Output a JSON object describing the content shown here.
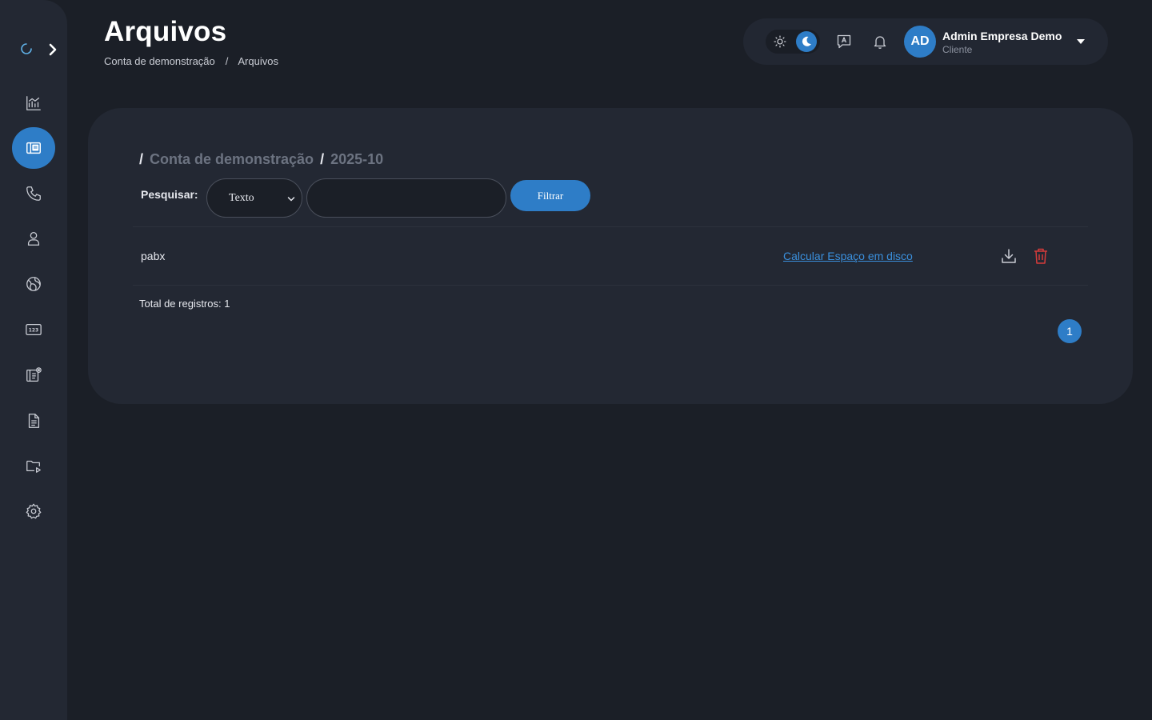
{
  "header": {
    "title": "Arquivos",
    "breadcrumb": [
      "Conta de demonstração",
      "Arquivos"
    ],
    "breadcrumb_separator": "/"
  },
  "sidebar": {
    "items": [
      {
        "icon": "chart-icon",
        "active": false
      },
      {
        "icon": "files-icon",
        "active": true
      },
      {
        "icon": "phone-icon",
        "active": false
      },
      {
        "icon": "user-icon",
        "active": false
      },
      {
        "icon": "globe-icon",
        "active": false
      },
      {
        "icon": "numbers-icon",
        "active": false
      },
      {
        "icon": "book-settings-icon",
        "active": false
      },
      {
        "icon": "document-icon",
        "active": false
      },
      {
        "icon": "folder-play-icon",
        "active": false
      },
      {
        "icon": "gear-icon",
        "active": false
      }
    ]
  },
  "topbar": {
    "user_initials": "AD",
    "user_name": "Admin Empresa Demo",
    "user_role": "Cliente",
    "theme": "dark"
  },
  "content": {
    "path": [
      "Conta de demonstração",
      "2025-10"
    ],
    "path_separator": "/",
    "search": {
      "label": "Pesquisar:",
      "select_value": "Texto",
      "input_value": "",
      "button_label": "Filtrar"
    },
    "rows": [
      {
        "name": "pabx",
        "action_link": "Calcular Espaço em disco"
      }
    ],
    "total_label": "Total de registros: 1",
    "pagination": {
      "current_page": "1"
    }
  },
  "colors": {
    "accent": "#2e7dc7",
    "link": "#3a8fdc",
    "danger": "#d63b3b",
    "background": "#1b1f27",
    "panel": "#232833"
  }
}
